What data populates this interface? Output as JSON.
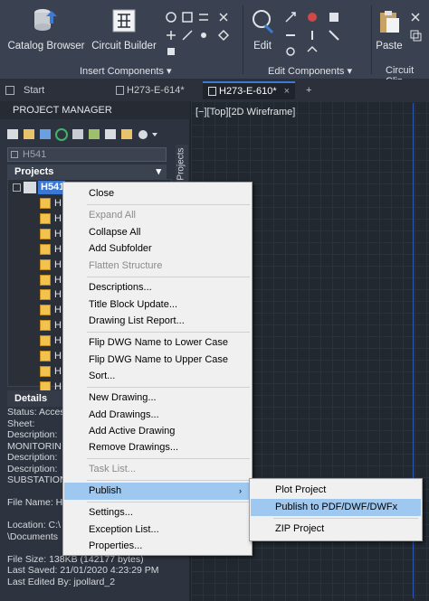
{
  "ribbon": {
    "catalog_browser": "Catalog Browser",
    "circuit_builder": "Circuit Builder",
    "insert_components": "Insert Components",
    "edit": "Edit",
    "edit_components": "Edit Components",
    "paste": "Paste",
    "circuit_clip": "Circuit Clip",
    "dropdown_glyph": "▾"
  },
  "tabs": [
    {
      "label": "Start"
    },
    {
      "label": "H273-E-614*"
    },
    {
      "label": "H273-E-610*"
    }
  ],
  "tab_close": "×",
  "tab_add": "+",
  "project_manager": {
    "title": "PROJECT MANAGER",
    "project_combo": "H541",
    "projects_header": "Projects",
    "vertical_tab": "Projects",
    "root": "H541",
    "items": [
      "H",
      "H",
      "H",
      "H",
      "H",
      "H",
      "H",
      "H",
      "H",
      "H",
      "H",
      "H",
      "H"
    ]
  },
  "details": {
    "header": "Details",
    "lines": [
      "Status: Acces",
      "Sheet:",
      "Description:",
      "MONITORIN",
      "Description:",
      "Description:",
      "SUBSTATION",
      "",
      "File Name: H",
      "",
      "Location: C:\\",
      "\\Documents",
      "",
      "File Size: 138KB (142177 bytes)",
      "Last Saved: 21/01/2020 4:23:29 PM",
      "Last Edited By: jpollard_2"
    ]
  },
  "drawing": {
    "view_label": "[−][Top][2D Wireframe]"
  },
  "context_menu": {
    "items": [
      {
        "label": "Close",
        "disabled": false
      },
      {
        "label": "Expand All",
        "disabled": true
      },
      {
        "label": "Collapse All",
        "disabled": false
      },
      {
        "label": "Add Subfolder",
        "disabled": false
      },
      {
        "label": "Flatten Structure",
        "disabled": true
      },
      {
        "label": "Descriptions...",
        "disabled": false
      },
      {
        "label": "Title Block Update...",
        "disabled": false
      },
      {
        "label": "Drawing List Report...",
        "disabled": false
      },
      {
        "label": "Flip DWG Name to Lower Case",
        "disabled": false
      },
      {
        "label": "Flip DWG Name to Upper Case",
        "disabled": false
      },
      {
        "label": "Sort...",
        "disabled": false
      },
      {
        "label": "New Drawing...",
        "disabled": false
      },
      {
        "label": "Add Drawings...",
        "disabled": false
      },
      {
        "label": "Add Active Drawing",
        "disabled": false
      },
      {
        "label": "Remove Drawings...",
        "disabled": false
      },
      {
        "label": "Task List...",
        "disabled": true
      },
      {
        "label": "Publish",
        "disabled": false
      },
      {
        "label": "Settings...",
        "disabled": false
      },
      {
        "label": "Exception List...",
        "disabled": false
      },
      {
        "label": "Properties...",
        "disabled": false
      }
    ],
    "submenu_arrow": "›"
  },
  "publish_submenu": {
    "items": [
      {
        "label": "Plot Project"
      },
      {
        "label": "Publish to PDF/DWF/DWFx"
      },
      {
        "label": "ZIP Project"
      }
    ]
  }
}
